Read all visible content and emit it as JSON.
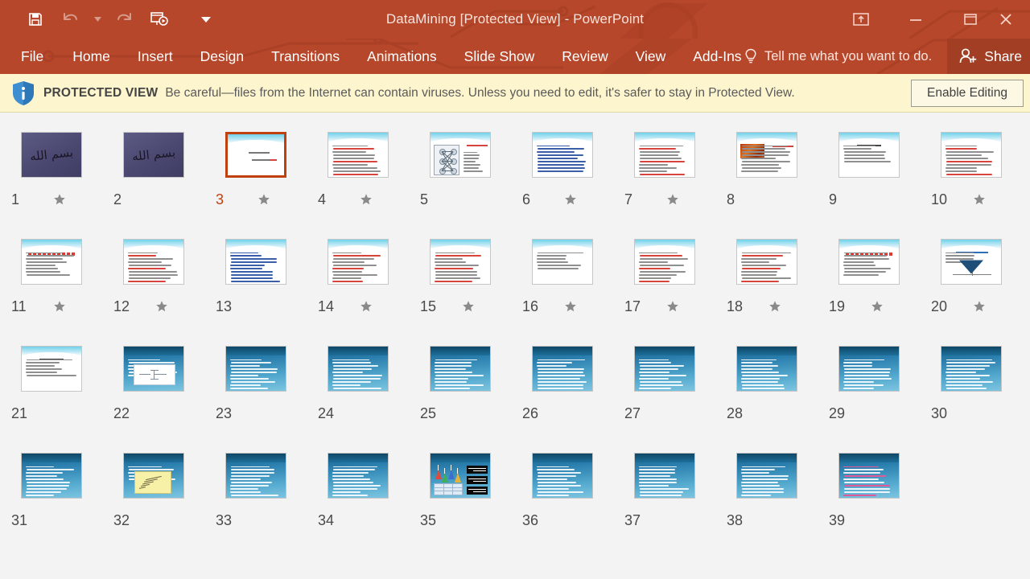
{
  "titlebar": {
    "title": "DataMining [Protected View] - PowerPoint",
    "quick_access": [
      {
        "name": "save-icon",
        "label": "Save",
        "enabled": true
      },
      {
        "name": "undo-icon",
        "label": "Undo",
        "enabled": false
      },
      {
        "name": "undo-dropdown-icon",
        "label": "Undo options",
        "enabled": false
      },
      {
        "name": "redo-icon",
        "label": "Redo",
        "enabled": false
      },
      {
        "name": "start-presentation-icon",
        "label": "Start From Beginning",
        "enabled": true
      },
      {
        "name": "customize-qat-icon",
        "label": "Customize Quick Access Toolbar",
        "enabled": true
      }
    ],
    "window_controls": [
      {
        "name": "ribbon-display-options-icon",
        "label": "Ribbon Display Options"
      },
      {
        "name": "minimize-icon",
        "label": "Minimize"
      },
      {
        "name": "restore-icon",
        "label": "Restore Down"
      },
      {
        "name": "close-icon",
        "label": "Close"
      }
    ]
  },
  "ribbon": {
    "tabs": [
      {
        "label": "File"
      },
      {
        "label": "Home"
      },
      {
        "label": "Insert"
      },
      {
        "label": "Design"
      },
      {
        "label": "Transitions"
      },
      {
        "label": "Animations"
      },
      {
        "label": "Slide Show"
      },
      {
        "label": "Review"
      },
      {
        "label": "View"
      },
      {
        "label": "Add-Ins"
      }
    ],
    "tell_me": "Tell me what you want to do.",
    "share_label": "Share"
  },
  "protected_view": {
    "badge": "PROTECTED VIEW",
    "message": "Be careful—files from the Internet can contain viruses. Unless you need to edit, it's safer to stay in Protected View.",
    "button": "Enable Editing"
  },
  "colors": {
    "titlebar": "#b7472a",
    "share_button": "#a23e24",
    "protected_view_bg": "#fdf5ce",
    "selection": "#c0400f",
    "slide_number": "#4a4a4a"
  },
  "slide_sorter": {
    "slides": [
      {
        "number": "1",
        "starred": true,
        "selected": false,
        "style": "calligraphy"
      },
      {
        "number": "2",
        "starred": false,
        "selected": false,
        "style": "calligraphy"
      },
      {
        "number": "3",
        "starred": true,
        "selected": true,
        "style": "title-light"
      },
      {
        "number": "4",
        "starred": true,
        "selected": false,
        "style": "text-light"
      },
      {
        "number": "5",
        "starred": false,
        "selected": false,
        "style": "neural-net"
      },
      {
        "number": "6",
        "starred": true,
        "selected": false,
        "style": "bullets-blue"
      },
      {
        "number": "7",
        "starred": true,
        "selected": false,
        "style": "text-light"
      },
      {
        "number": "8",
        "starred": false,
        "selected": false,
        "style": "photo-light"
      },
      {
        "number": "9",
        "starred": false,
        "selected": false,
        "style": "heading-light"
      },
      {
        "number": "10",
        "starred": true,
        "selected": false,
        "style": "text-light"
      },
      {
        "number": "11",
        "starred": true,
        "selected": false,
        "style": "redbar-light"
      },
      {
        "number": "12",
        "starred": true,
        "selected": false,
        "style": "text-light"
      },
      {
        "number": "13",
        "starred": false,
        "selected": false,
        "style": "dense-light"
      },
      {
        "number": "14",
        "starred": true,
        "selected": false,
        "style": "text-light"
      },
      {
        "number": "15",
        "starred": true,
        "selected": false,
        "style": "text-light"
      },
      {
        "number": "16",
        "starred": true,
        "selected": false,
        "style": "sparse-light"
      },
      {
        "number": "17",
        "starred": true,
        "selected": false,
        "style": "text-light"
      },
      {
        "number": "18",
        "starred": true,
        "selected": false,
        "style": "text-light"
      },
      {
        "number": "19",
        "starred": true,
        "selected": false,
        "style": "redbar-light"
      },
      {
        "number": "20",
        "starred": true,
        "selected": false,
        "style": "gradient-descent"
      },
      {
        "number": "21",
        "starred": false,
        "selected": false,
        "style": "heading-light"
      },
      {
        "number": "22",
        "starred": false,
        "selected": false,
        "style": "dark-diagram"
      },
      {
        "number": "23",
        "starred": false,
        "selected": false,
        "style": "dark-text"
      },
      {
        "number": "24",
        "starred": false,
        "selected": false,
        "style": "dark-text"
      },
      {
        "number": "25",
        "starred": false,
        "selected": false,
        "style": "dark-text"
      },
      {
        "number": "26",
        "starred": false,
        "selected": false,
        "style": "dark-text"
      },
      {
        "number": "27",
        "starred": false,
        "selected": false,
        "style": "dark-text"
      },
      {
        "number": "28",
        "starred": false,
        "selected": false,
        "style": "dark-text"
      },
      {
        "number": "29",
        "starred": false,
        "selected": false,
        "style": "dark-text"
      },
      {
        "number": "30",
        "starred": false,
        "selected": false,
        "style": "dark-text"
      },
      {
        "number": "31",
        "starred": false,
        "selected": false,
        "style": "dark-text"
      },
      {
        "number": "32",
        "starred": false,
        "selected": false,
        "style": "dark-note"
      },
      {
        "number": "33",
        "starred": false,
        "selected": false,
        "style": "dark-text"
      },
      {
        "number": "34",
        "starred": false,
        "selected": false,
        "style": "dark-text"
      },
      {
        "number": "35",
        "starred": false,
        "selected": false,
        "style": "dark-chart"
      },
      {
        "number": "36",
        "starred": false,
        "selected": false,
        "style": "dark-text"
      },
      {
        "number": "37",
        "starred": false,
        "selected": false,
        "style": "dark-text"
      },
      {
        "number": "38",
        "starred": false,
        "selected": false,
        "style": "dark-text"
      },
      {
        "number": "39",
        "starred": false,
        "selected": false,
        "style": "dark-pink"
      }
    ]
  }
}
